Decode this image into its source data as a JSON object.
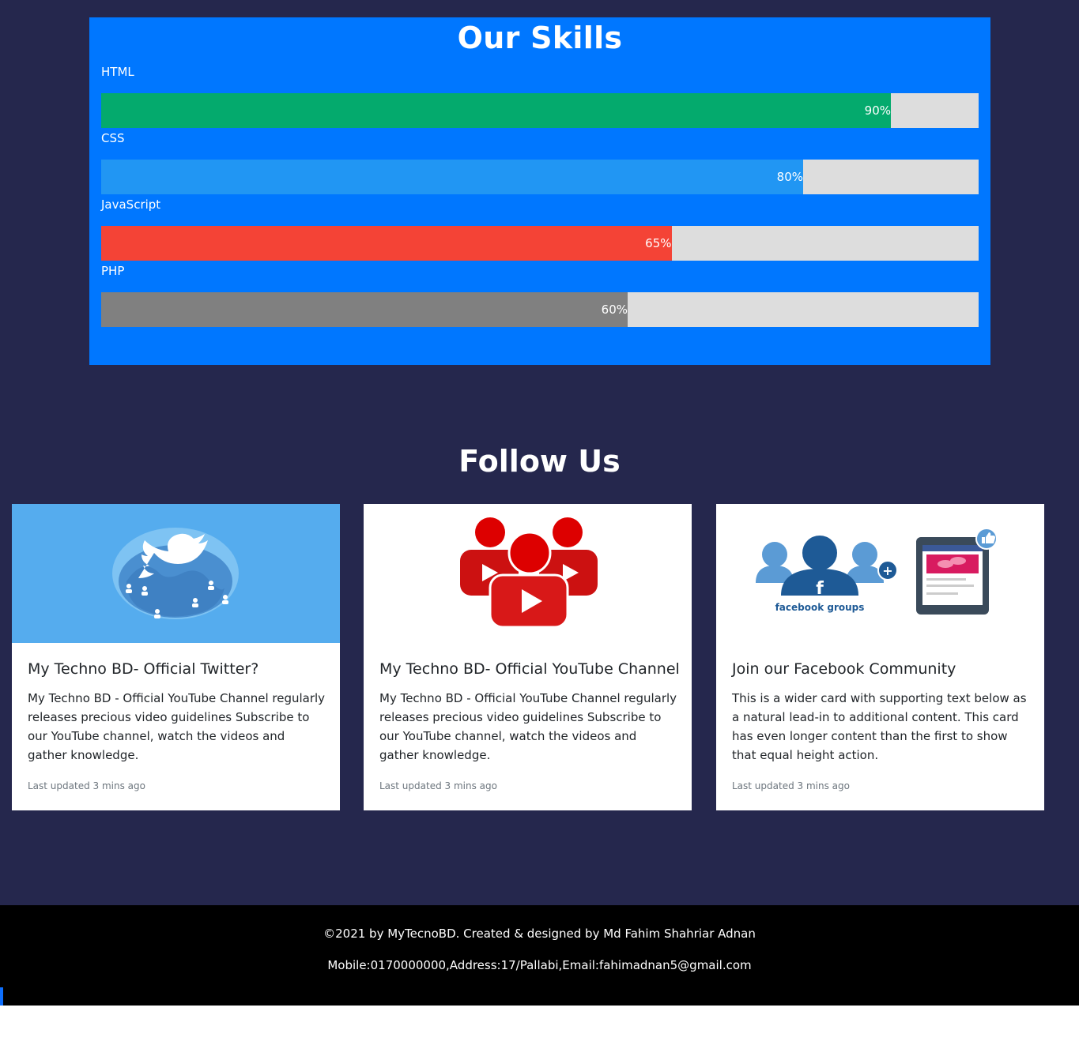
{
  "skills": {
    "title": "Our Skills",
    "items": [
      {
        "label": "HTML",
        "percent": 90,
        "percent_text": "90%",
        "color": "#04aa6d"
      },
      {
        "label": "CSS",
        "percent": 80,
        "percent_text": "80%",
        "color": "#2196f3"
      },
      {
        "label": "JavaScript",
        "percent": 65,
        "percent_text": "65%",
        "color": "#f44336"
      },
      {
        "label": "PHP",
        "percent": 60,
        "percent_text": "60%",
        "color": "#808080"
      }
    ],
    "track_color": "#dddddd",
    "box_color": "#0077ff"
  },
  "follow": {
    "title": "Follow Us",
    "cards": [
      {
        "image_icon": "twitter-globe-icon",
        "title": "My Techno BD- Official Twitter?",
        "text": "My Techno BD - Official YouTube Channel regularly releases precious video guidelines Subscribe to our YouTube channel, watch the videos and gather knowledge.",
        "updated": "Last updated 3 mins ago"
      },
      {
        "image_icon": "youtube-community-icon",
        "title": "My Techno BD- Official YouTube Channel",
        "text": "My Techno BD - Official YouTube Channel regularly releases precious video guidelines Subscribe to our YouTube channel, watch the videos and gather knowledge.",
        "updated": "Last updated 3 mins ago"
      },
      {
        "image_icon": "facebook-groups-icon",
        "image_caption": "facebook groups",
        "title": "Join our Facebook Community",
        "text": "This is a wider card with supporting text below as a natural lead-in to additional content. This card has even longer content than the first to show that equal height action.",
        "updated": "Last updated 3 mins ago"
      }
    ]
  },
  "footer": {
    "copyright": "©2021 by MyTecnoBD. Created & designed by Md Fahim Shahriar Adnan",
    "contact": "Mobile:0170000000,Address:17/Pallabi,Email:fahimadnan5@gmail.com"
  },
  "colors": {
    "page_bg": "#25274d",
    "footer_bg": "#000000",
    "twitter_blue": "#55acee",
    "youtube_red": "#dd0000",
    "facebook_blue": "#1e5a96"
  }
}
